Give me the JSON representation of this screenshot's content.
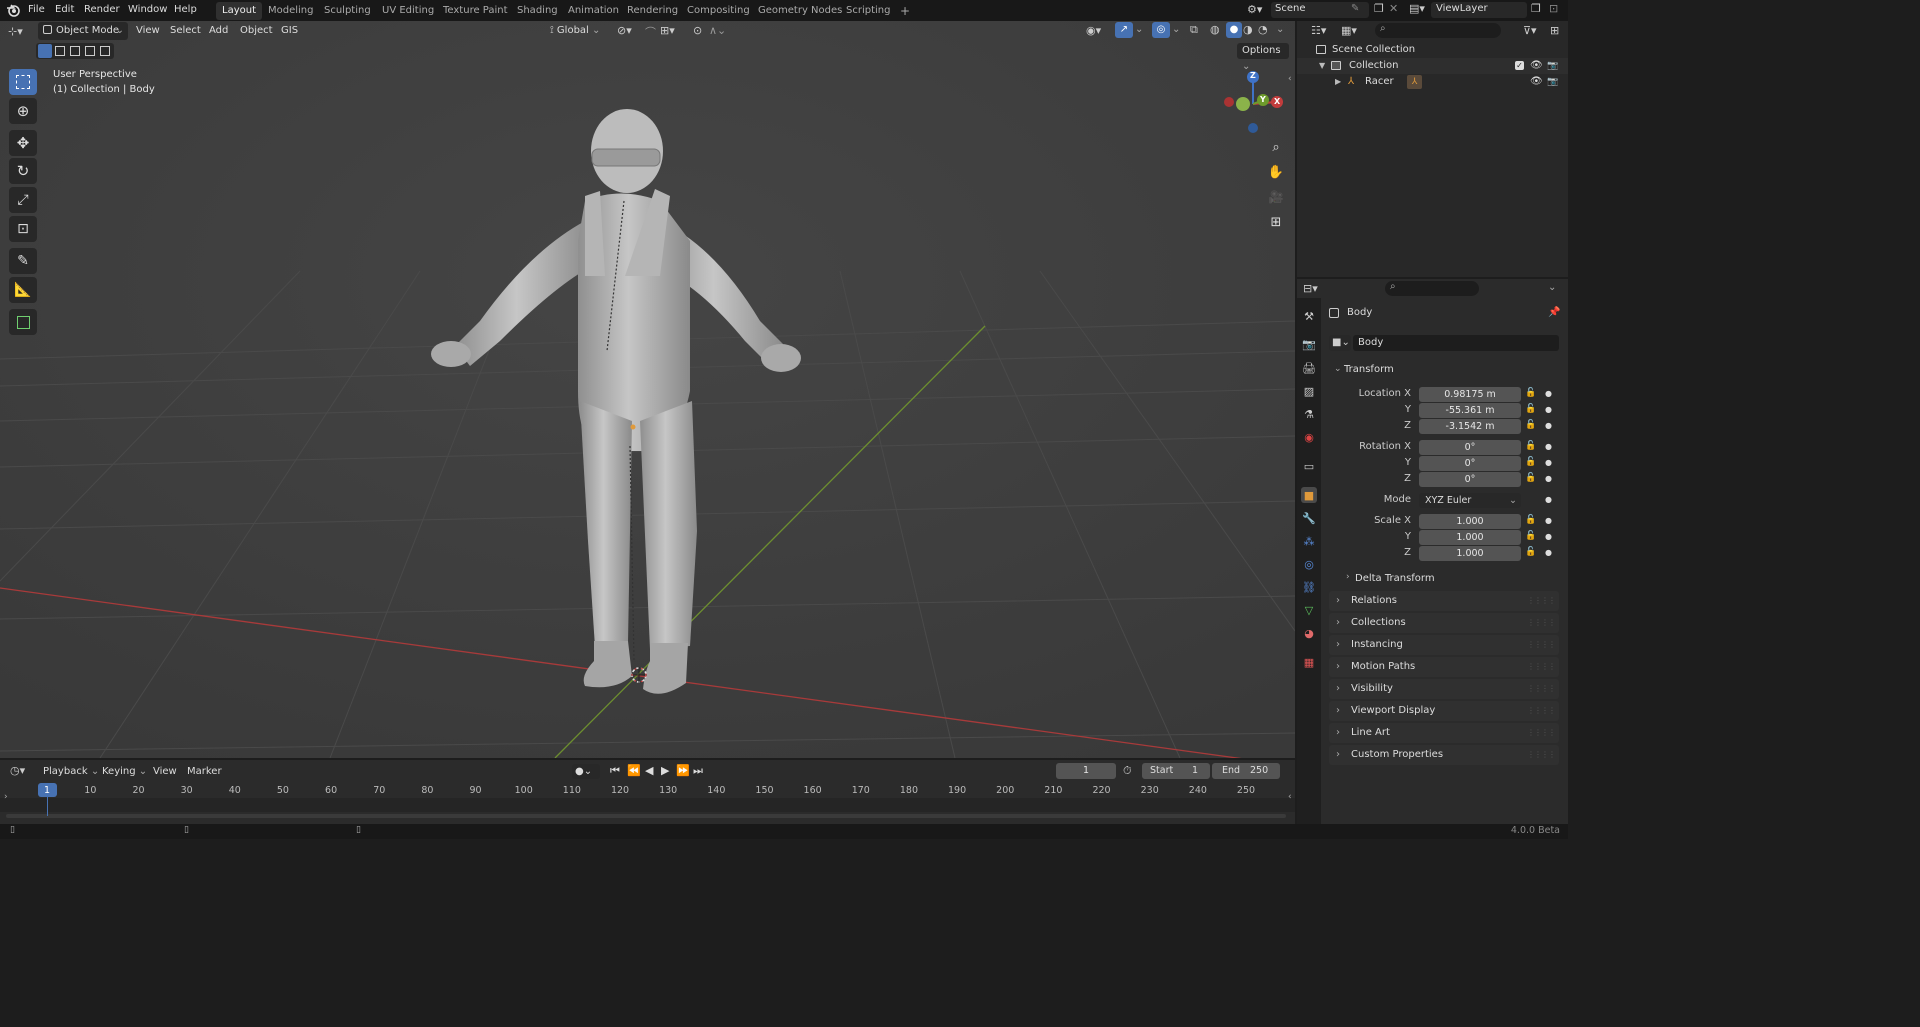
{
  "topbar": {
    "menus": [
      "File",
      "Edit",
      "Render",
      "Window",
      "Help"
    ],
    "workspaces": [
      "Layout",
      "Modeling",
      "Sculpting",
      "UV Editing",
      "Texture Paint",
      "Shading",
      "Animation",
      "Rendering",
      "Compositing",
      "Geometry Nodes",
      "Scripting"
    ],
    "active_workspace": "Layout",
    "add_tab": "+",
    "scene": "Scene",
    "view_layer": "ViewLayer"
  },
  "viewport_header": {
    "mode": "Object Mode",
    "menus": [
      "View",
      "Select",
      "Add",
      "Object",
      "GIS"
    ],
    "orientation": "Global",
    "options": "Options"
  },
  "viewport": {
    "perspective": "User Perspective",
    "context": "(1) Collection | Body",
    "gizmo": {
      "x": "X",
      "y": "Y",
      "z": "Z"
    }
  },
  "outliner": {
    "scene_collection": "Scene Collection",
    "collection": "Collection",
    "object": "Racer"
  },
  "properties": {
    "object_name": "Body",
    "data_name": "Body",
    "transform_label": "Transform",
    "location": {
      "label": "Location X",
      "x": "0.98175 m",
      "y": "-55.361 m",
      "z": "-3.1542 m"
    },
    "rotation": {
      "label": "Rotation X",
      "x": "0°",
      "y": "0°",
      "z": "0°"
    },
    "mode": {
      "label": "Mode",
      "value": "XYZ Euler"
    },
    "scale": {
      "label": "Scale X",
      "x": "1.000",
      "y": "1.000",
      "z": "1.000"
    },
    "axis_y": "Y",
    "axis_z": "Z",
    "delta": "Delta Transform",
    "panels": [
      "Relations",
      "Collections",
      "Instancing",
      "Motion Paths",
      "Visibility",
      "Viewport Display",
      "Line Art",
      "Custom Properties"
    ]
  },
  "timeline": {
    "menus": [
      "Playback",
      "Keying",
      "View",
      "Marker"
    ],
    "current_frame": "1",
    "start_label": "Start",
    "start": "1",
    "end_label": "End",
    "end": "250",
    "ticks": [
      "1",
      "10",
      "20",
      "30",
      "40",
      "50",
      "60",
      "70",
      "80",
      "90",
      "100",
      "110",
      "120",
      "130",
      "140",
      "150",
      "160",
      "170",
      "180",
      "190",
      "200",
      "210",
      "220",
      "230",
      "240",
      "250"
    ]
  },
  "status": {
    "version": "4.0.0 Beta"
  },
  "colors": {
    "accent": "#4772b3",
    "x_axis": "#c33c3c",
    "y_axis": "#6d9a2c",
    "z_axis": "#3f73c8",
    "object_orange": "#e09a3b"
  }
}
